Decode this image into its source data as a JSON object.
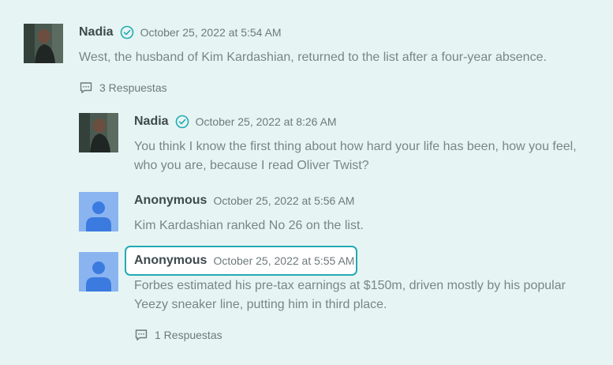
{
  "colors": {
    "accent": "#23aab3",
    "background": "#e6f5f3",
    "anon_avatar": "#8ab4f0",
    "anon_silhouette": "#3b7be0"
  },
  "comments": [
    {
      "author": "Nadia",
      "verified": true,
      "avatar": "photo",
      "date": "October 25, 2022 at 5:54 AM",
      "text": "West, the husband of Kim Kardashian, returned to the list after a four-year absence.",
      "replies_label": "3 Respuestas"
    },
    {
      "author": "Nadia",
      "verified": true,
      "avatar": "photo",
      "date": "October 25, 2022 at 8:26 AM",
      "text": "You think I know the first thing about how hard your life has been, how you feel, who you are, because I read Oliver Twist?"
    },
    {
      "author": "Anonymous",
      "verified": false,
      "avatar": "anonymous-user",
      "date": "October 25, 2022 at 5:56 AM",
      "text": "Kim Kardashian ranked No 26 on the list."
    },
    {
      "author": "Anonymous",
      "verified": false,
      "avatar": "anonymous-user",
      "date": "October 25, 2022 at 5:55 AM",
      "focused": true,
      "text": "Forbes estimated his pre-tax earnings at $150m, driven mostly by his popular Yeezy sneaker line, putting him in third place.",
      "replies_label": "1 Respuestas"
    }
  ]
}
